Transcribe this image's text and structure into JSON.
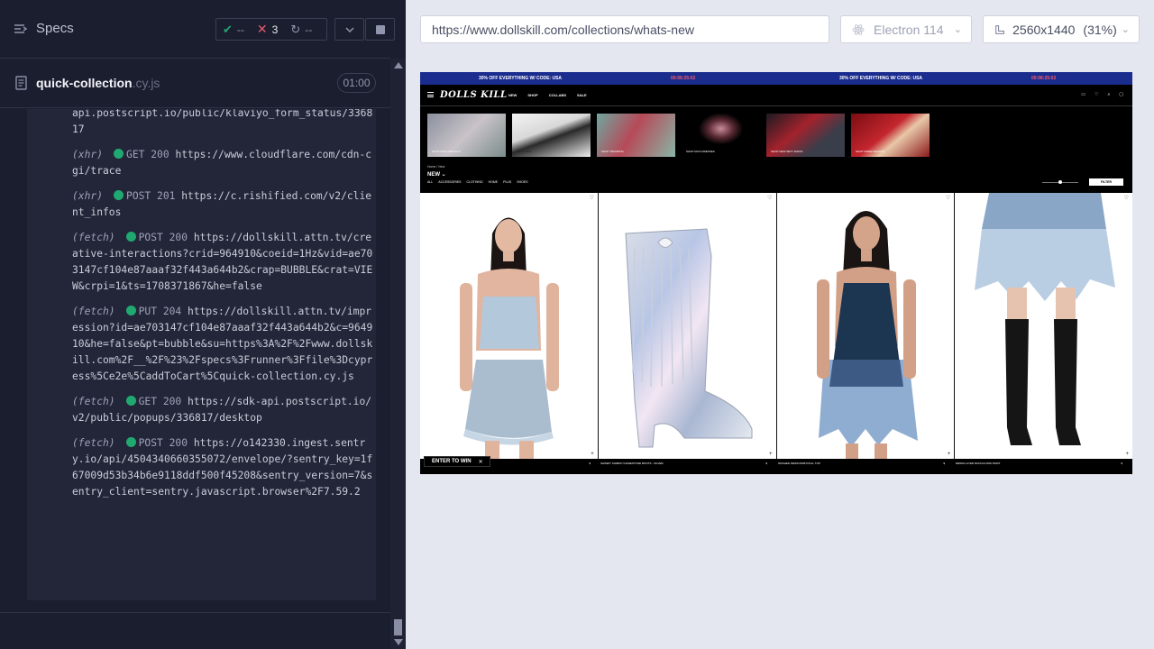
{
  "reporter": {
    "specs_label": "Specs",
    "stats": {
      "passed": "--",
      "failed": "3",
      "pending": "--"
    },
    "spec": {
      "name": "quick-collection",
      "ext": ".cy.js",
      "time": "01:00"
    },
    "log": [
      {
        "tag": "",
        "method": "",
        "url": "api.postscript.io/public/klaviyo_form_status/336817"
      },
      {
        "tag": "(xhr)",
        "method": "GET 200",
        "url": "https://www.cloudflare.com/cdn-cgi/trace"
      },
      {
        "tag": "(xhr)",
        "method": "POST 201",
        "url": "https://c.rishified.com/v2/client_infos"
      },
      {
        "tag": "(fetch)",
        "method": "POST 200",
        "url": "https://dollskill.attn.tv/creative-interactions?crid=964910&coeid=1Hz&vid=ae703147cf104e87aaaf32f443a644b2&crap=BUBBLE&crat=VIEW&crpi=1&ts=1708371867&he=false"
      },
      {
        "tag": "(fetch)",
        "method": "PUT 204",
        "url": "https://dollskill.attn.tv/impression?id=ae703147cf104e87aaaf32f443a644b2&c=964910&he=false&pt=bubble&su=https%3A%2F%2Fwww.dollskill.com%2F__%2F%23%2Fspecs%3Frunner%3Ffile%3Dcypress%5Ce2e%5CaddToCart%5Cquick-collection.cy.js"
      },
      {
        "tag": "(fetch)",
        "method": "GET 200",
        "url": "https://sdk-api.postscript.io/v2/public/popups/336817/desktop"
      },
      {
        "tag": "(fetch)",
        "method": "POST 200",
        "url": "https://o142330.ingest.sentry.io/api/4504340660355072/envelope/?sentry_key=1f67009d53b34b6e9118ddf500f45208&sentry_version=7&sentry_client=sentry.javascript.browser%2F7.59.2"
      }
    ]
  },
  "toolbar": {
    "url": "https://www.dollskill.com/collections/whats-new",
    "browser": "Electron 114",
    "viewport": "2560x1440",
    "zoom": "(31%)"
  },
  "site": {
    "promo_left": "30% OFF EVERYTHING W/ CODE: USA",
    "promo_right": "30% OFF EVERYTHING W/ CODE: USA",
    "timer_1": "00:06:25:02",
    "timer_2": "00:06:25:02",
    "logo": "DOLLS KILL",
    "nav": [
      "NEW",
      "SHOP",
      "COLLABS",
      "SALE"
    ],
    "thumbs": [
      "SHOP NEW ARRIVALS",
      "SHOP NEW",
      "SHOP TRENDING",
      "SHOP MAXI DRESSES",
      "SHOP NEW SEXY MAIDS",
      "SHOP SWEETHEARTS"
    ],
    "breadcrumb": "Home / New",
    "title": "NEW",
    "categories": [
      "ALL",
      "ACCESSORIES",
      "CLOTHING",
      "HOME",
      "PLUS",
      "SHOES"
    ],
    "filter": "FILTER",
    "enter_to_win": "ENTER TO WIN",
    "products": [
      {
        "name": "",
        "price": "$",
        "sale": ""
      },
      {
        "name": "SHIMMY SHIMMY RHINESTONE BOOTS - SILVER",
        "price": "$",
        "sale": ""
      },
      {
        "name": "WASHED DENIM BABYDOLL TOP",
        "price": "$",
        "sale": ""
      },
      {
        "name": "DENIM LAYER RUFFLE MINI SKIRT",
        "price": "$",
        "sale": ""
      }
    ]
  },
  "colors": {
    "accent_green": "#1fa971",
    "accent_red": "#e45770",
    "promo_blue": "#1a2c8e"
  }
}
